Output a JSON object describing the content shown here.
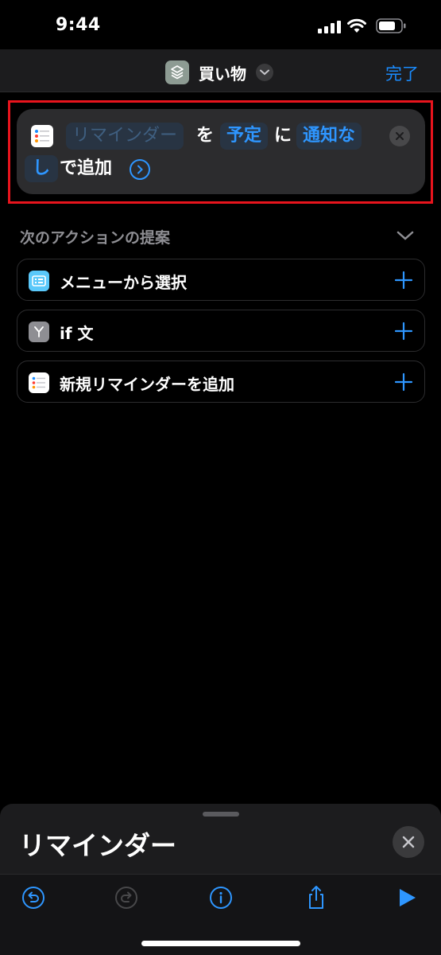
{
  "status_bar": {
    "time": "9:44"
  },
  "nav": {
    "title": "買い物",
    "done_label": "完了"
  },
  "action": {
    "param_reminder_placeholder": "リマインダー",
    "word_wo": "を",
    "param_list": "予定",
    "word_ni": "に",
    "param_alert_part1": "通知な",
    "param_alert_part2": "し",
    "word_add": "で追加"
  },
  "suggestions": {
    "header": "次のアクションの提案",
    "items": [
      {
        "label": "メニューから選択",
        "icon": "menu-icon",
        "icon_color": "#5ac8fa"
      },
      {
        "label": "if 文",
        "icon": "branch-icon",
        "icon_color": "#8e8e93"
      },
      {
        "label": "新規リマインダーを追加",
        "icon": "reminders-icon",
        "icon_color": "#ffffff"
      }
    ]
  },
  "sheet": {
    "title": "リマインダー"
  },
  "toolbar": {
    "buttons": [
      "undo-icon",
      "redo-icon",
      "info-icon",
      "share-icon",
      "play-icon"
    ]
  },
  "colors": {
    "accent": "#2e96ff",
    "highlight": "#e8141d",
    "background": "#000000"
  }
}
